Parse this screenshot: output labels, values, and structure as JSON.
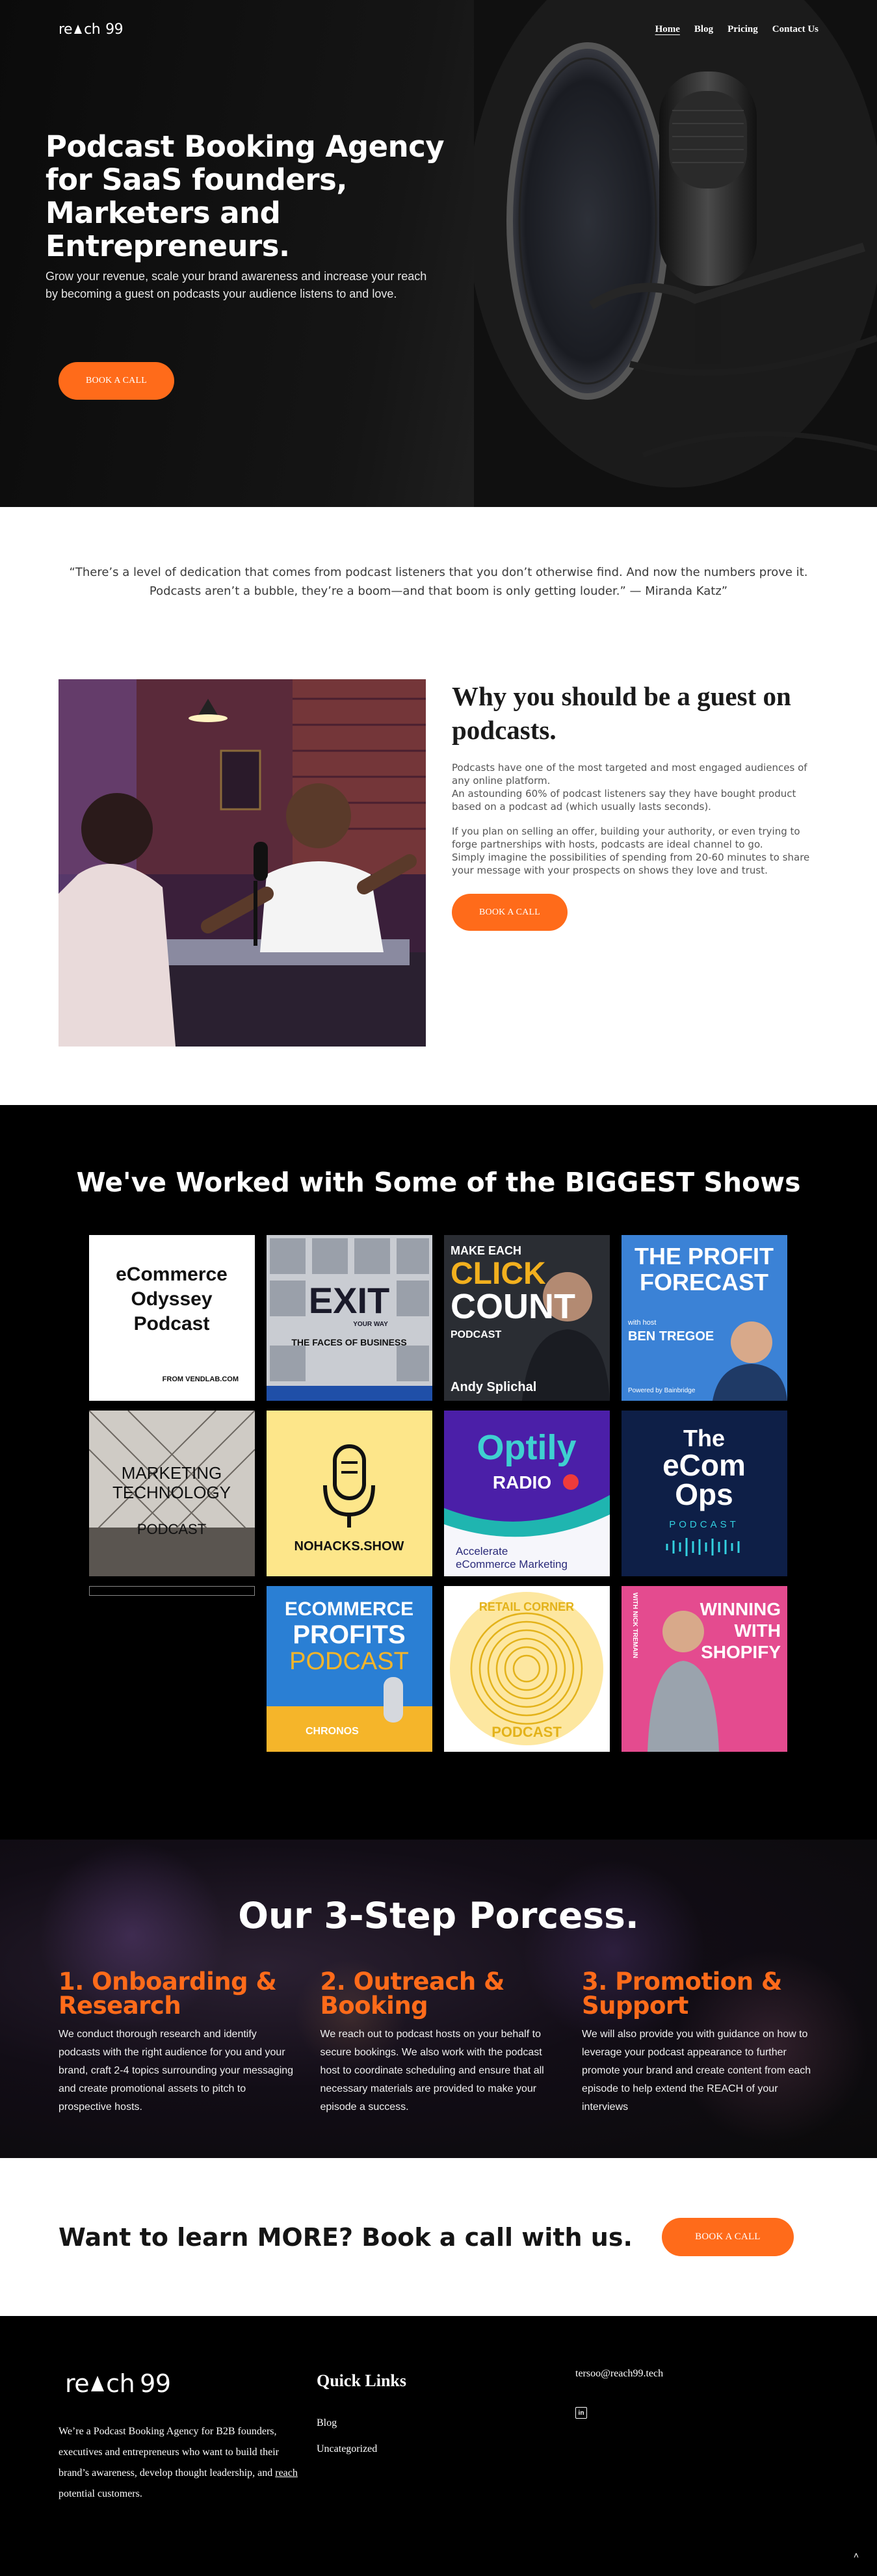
{
  "nav": {
    "logo_pre": "re",
    "logo_post": "ch",
    "logo_num": "99",
    "links": [
      "Home",
      "Blog",
      "Pricing",
      "Contact Us"
    ],
    "active": "Home"
  },
  "hero": {
    "title": "Podcast Booking Agency for SaaS founders, Marketers and Entrepreneurs.",
    "subtitle": "Grow your revenue, scale your brand awareness and increase your reach by becoming a guest on podcasts your audience listens to and love.",
    "cta": "BOOK A CALL"
  },
  "quote": {
    "text": "“There’s a level of dedication that comes from podcast listeners that you don’t otherwise find. And now the numbers prove it. Podcasts aren’t a bubble, they’re a boom—and that boom is only getting louder.” — Miranda Katz”"
  },
  "why": {
    "title": "Why you should be a guest on podcasts.",
    "p1": "Podcasts have one of the most targeted and most engaged audiences of any online platform.",
    "p2": "An astounding 60% of podcast listeners say they have bought product based on a podcast ad (which usually lasts seconds).",
    "p3": "If you plan on selling an offer, building your authority, or even trying to forge partnerships with hosts, podcasts are ideal channel to go.",
    "p4": "Simply imagine the possibilities of spending from 20-60 minutes to share your message with your prospects on shows they love and trust.",
    "cta": "BOOK A CALL"
  },
  "shows": {
    "title": "We've Worked with Some of the BIGGEST Shows",
    "tiles": {
      "ecommerce_odyssey": {
        "l1": "eCommerce",
        "l2": "Odyssey",
        "l3": "Podcast",
        "footer": "FROM VENDLAB.COM"
      },
      "exit": {
        "logo": "EXIT",
        "tag": "YOUR WAY",
        "caption": "THE FACES OF BUSINESS"
      },
      "click_count": {
        "l1": "MAKE EACH",
        "l2": "CLICK",
        "l3": "COUNT",
        "l4": "PODCAST",
        "host": "Andy Splichal"
      },
      "profit_forecast": {
        "l1": "THE PROFIT",
        "l2": "FORECAST",
        "l3": "with host",
        "host": "BEN TREGOE",
        "powered": "Powered by Bainbridge"
      },
      "marketing_tech": {
        "l1": "MARKETING",
        "l2": "TECHNOLOGY",
        "l3": "PODCAST"
      },
      "nohacks": {
        "name": "NOHACKS.SHOW"
      },
      "optily": {
        "brand": "Optily",
        "radio": "RADIO",
        "tag1": "Accelerate",
        "tag2": "eCommerce Marketing"
      },
      "ecom_ops": {
        "l1": "The",
        "l2": "eCom",
        "l3": "Ops",
        "l4": "PODCAST"
      },
      "ecom_profits": {
        "l1": "ECOMMERCE",
        "l2": "PROFITS",
        "l3": "PODCAST",
        "brand": "CHRONOS"
      },
      "retail_corner": {
        "top": "RETAIL CORNER",
        "bottom": "PODCAST"
      },
      "winning_shopify": {
        "l1": "WINNING",
        "l2": "WITH",
        "l3": "SHOPIFY",
        "side": "WITH NICK TREMAIN"
      }
    }
  },
  "process": {
    "title": "Our 3-Step Porcess.",
    "steps": [
      {
        "title": "1. Onboarding & Research",
        "body": "We conduct thorough research and identify podcasts with the right audience for you and your brand, craft 2-4 topics surrounding your messaging and create promotional assets to pitch to prospective hosts."
      },
      {
        "title": "2. Outreach & Booking",
        "body": "We reach out to podcast hosts on your behalf to secure bookings. We also work with the podcast host to coordinate scheduling and ensure that all necessary materials are provided to make your episode a success."
      },
      {
        "title": "3. Promotion & Support",
        "body": "We will also provide you with guidance on how to leverage your podcast appearance to further promote your brand and create content from each episode to help extend the REACH of your interviews"
      }
    ]
  },
  "cta": {
    "title": "Want to learn MORE? Book a call with us.",
    "button": "BOOK A CALL"
  },
  "footer": {
    "about_pre": "We’re a Podcast Booking Agency for B2B founders, executives and entrepreneurs who want to build their brand’s awareness, develop thought leadership, and ",
    "about_link": "reach",
    "about_post": " potential customers.",
    "quick_links_title": "Quick Links",
    "quick_links": [
      "Blog",
      "Uncategorized"
    ],
    "email": "tersoo@reach99.tech",
    "linkedin_icon": "in",
    "to_top": "˄"
  },
  "colors": {
    "accent": "#ff6b1a",
    "dark": "#000000"
  }
}
